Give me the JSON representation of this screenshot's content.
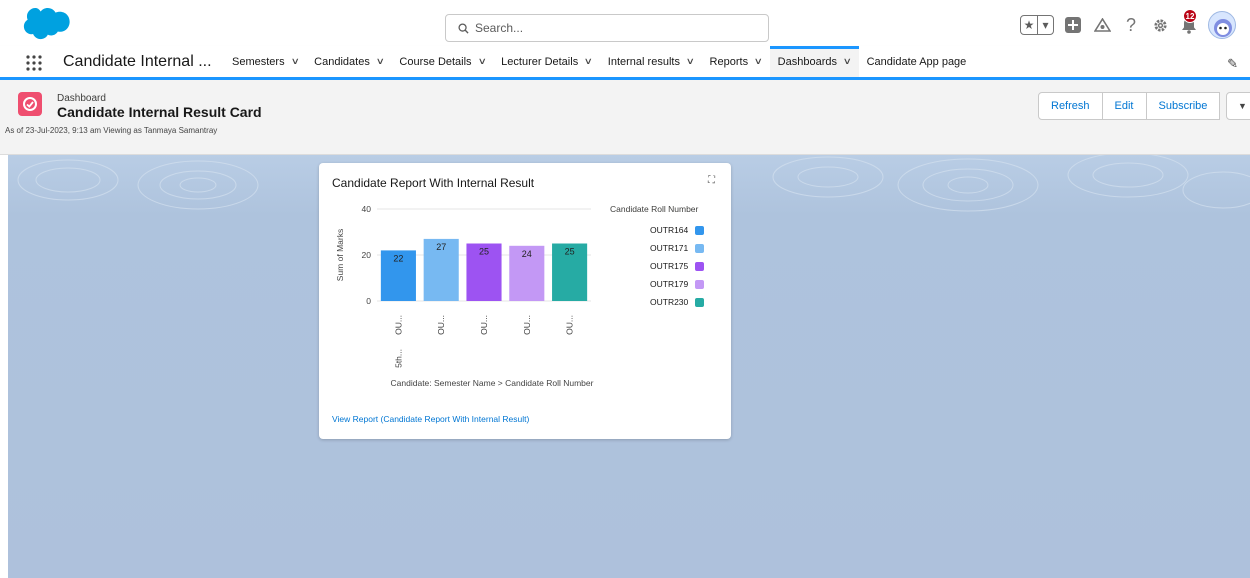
{
  "header": {
    "search_placeholder": "Search...",
    "notification_count": "12"
  },
  "nav": {
    "app_name": "Candidate Internal ...",
    "items": [
      {
        "label": "Semesters",
        "has_menu": true
      },
      {
        "label": "Candidates",
        "has_menu": true
      },
      {
        "label": "Course Details",
        "has_menu": true
      },
      {
        "label": "Lecturer Details",
        "has_menu": true
      },
      {
        "label": "Internal results",
        "has_menu": true
      },
      {
        "label": "Reports",
        "has_menu": true
      },
      {
        "label": "Dashboards",
        "has_menu": true,
        "active": true
      },
      {
        "label": "Candidate App page",
        "has_menu": false
      }
    ]
  },
  "dashboard": {
    "type_label": "Dashboard",
    "title": "Candidate Internal Result Card",
    "subtitle": "As of 23-Jul-2023, 9:13 am Viewing as Tanmaya Samantray",
    "buttons": {
      "refresh": "Refresh",
      "edit": "Edit",
      "subscribe": "Subscribe"
    }
  },
  "card": {
    "title": "Candidate Report With Internal Result",
    "view_report_link": "View Report (Candidate Report With Internal Result)"
  },
  "colors": {
    "accent": "#1b96ff",
    "dashboard_icon": "#ef4e6f",
    "link": "#0176d3",
    "canvas": "#aec3dd"
  },
  "chart_data": {
    "type": "bar",
    "ylabel": "Sum of Marks",
    "xlabel": "Candidate: Semester Name > Candidate Roll Number",
    "ylim": [
      0,
      40
    ],
    "yticks": [
      0,
      20,
      40
    ],
    "group_label": "5th...",
    "categories": [
      "OU...",
      "OU...",
      "OU...",
      "OU...",
      "OU..."
    ],
    "values": [
      22,
      27,
      25,
      24,
      25
    ],
    "colors": [
      "#3296ed",
      "#77b9f2",
      "#9d53f2",
      "#c398f5",
      "#26aba4"
    ],
    "legend_title": "Candidate Roll Number",
    "legend": [
      "OUTR164",
      "OUTR171",
      "OUTR175",
      "OUTR179",
      "OUTR230"
    ],
    "legend_position": "right",
    "grid": true
  }
}
